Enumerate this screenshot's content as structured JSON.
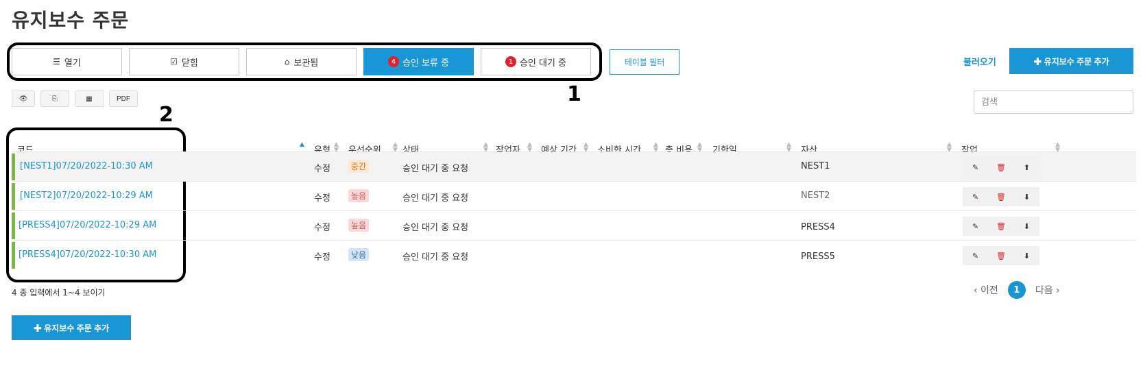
{
  "page": {
    "title": "유지보수 주문"
  },
  "tabs": [
    {
      "icon": "list-icon",
      "icon_glyph": "☰",
      "label": "열기",
      "badge": ""
    },
    {
      "icon": "checkbox-icon",
      "icon_glyph": "☑",
      "label": "닫힘",
      "badge": ""
    },
    {
      "icon": "inbox-icon",
      "icon_glyph": "⌂",
      "label": "보관됨",
      "badge": ""
    },
    {
      "icon": "",
      "icon_glyph": "",
      "label": "승인 보류 중",
      "badge": "4"
    },
    {
      "icon": "",
      "icon_glyph": "",
      "label": "승인 대기 중",
      "badge": "1"
    }
  ],
  "table_filter": {
    "label": "테이블 필터"
  },
  "header_actions": {
    "load_label": "불러오기",
    "add_label": "✚ 유지보수 주문 추가"
  },
  "toolbar": {
    "view_glyph": "👁",
    "copy_glyph": "⎘",
    "excel_glyph": "▦",
    "pdf_label": "PDF"
  },
  "search": {
    "placeholder": "검색"
  },
  "columns": {
    "code": "코드",
    "type": "유형",
    "priority": "우선순위",
    "status": "상태",
    "worker": "작업자",
    "estimated": "예상 기간",
    "spent": "소비한 시간",
    "total_cost": "총 비용",
    "due": "기한일",
    "asset": "자산",
    "action": "작업"
  },
  "rows": [
    {
      "code": "[NEST1]07/20/2022-10:30 AM",
      "type": "수정",
      "priority": "중간",
      "priority_level": "mid",
      "status": "승인 대기 중 요청",
      "asset": "NEST1"
    },
    {
      "code": "[NEST2]07/20/2022-10:29 AM",
      "type": "수정",
      "priority": "높음",
      "priority_level": "high",
      "status": "승인 대기 중 요청",
      "asset": "NEST2"
    },
    {
      "code": "[PRESS4]07/20/2022-10:29 AM",
      "type": "수정",
      "priority": "높음",
      "priority_level": "high",
      "status": "승인 대기 중 요청",
      "asset": "PRESS4"
    },
    {
      "code": "[PRESS4]07/20/2022-10:30 AM",
      "type": "수정",
      "priority": "낮음",
      "priority_level": "low",
      "status": "승인 대기 중 요청",
      "asset": "PRESS5"
    }
  ],
  "row_actions": {
    "edit_glyph": "✎",
    "delete_glyph": "🗑",
    "upload_glyph": "⬆",
    "download_glyph": "⬇"
  },
  "summary": "4 종 입력에서 1~4 보이기",
  "pagination": {
    "prev": "‹ 이전",
    "current": "1",
    "next": "다음 ›"
  },
  "footer": {
    "add_label": "✚ 유지보수 주문 추가"
  },
  "callouts": {
    "one": "1",
    "two": "2"
  },
  "colors": {
    "accent": "#1a96d4",
    "badge": "#d9262a",
    "row_marker": "#7ab648"
  }
}
